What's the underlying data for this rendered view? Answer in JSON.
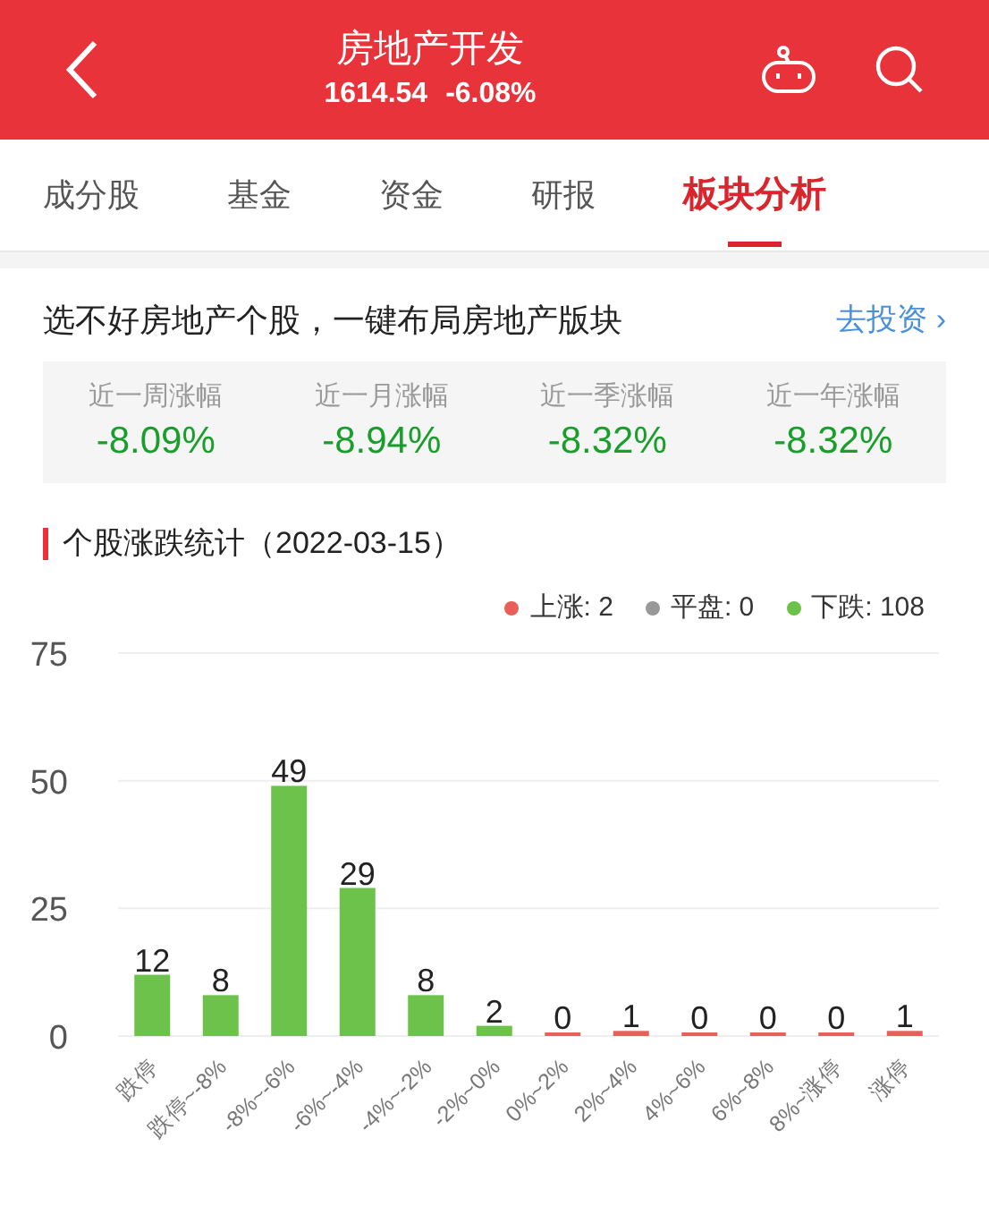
{
  "header": {
    "title": "房地产开发",
    "price": "1614.54",
    "change": "-6.08%"
  },
  "tabs": [
    {
      "label": "成分股",
      "selected": false
    },
    {
      "label": "基金",
      "selected": false
    },
    {
      "label": "资金",
      "selected": false
    },
    {
      "label": "研报",
      "selected": false
    },
    {
      "label": "板块分析",
      "selected": true
    }
  ],
  "promo": {
    "text": "选不好房地产个股，一键布局房地产版块",
    "link": "去投资",
    "arrow": "›"
  },
  "stats": [
    {
      "label": "近一周涨幅",
      "value": "-8.09%"
    },
    {
      "label": "近一月涨幅",
      "value": "-8.94%"
    },
    {
      "label": "近一季涨幅",
      "value": "-8.32%"
    },
    {
      "label": "近一年涨幅",
      "value": "-8.32%"
    }
  ],
  "section": {
    "title": "个股涨跌统计（2022-03-15）",
    "legend": [
      {
        "label": "上涨: 2",
        "color": "#e8605a"
      },
      {
        "label": "平盘: 0",
        "color": "#999999"
      },
      {
        "label": "下跌: 108",
        "color": "#6cc24a"
      }
    ],
    "chart_data": {
      "type": "bar",
      "categories": [
        "跌停",
        "跌停~-8%",
        "-8%~-6%",
        "-6%~-4%",
        "-4%~-2%",
        "-2%~0%",
        "0%~2%",
        "2%~4%",
        "4%~6%",
        "6%~8%",
        "8%~涨停",
        "涨停"
      ],
      "series": [
        {
          "color": "#6cc24a",
          "values": [
            12,
            8,
            49,
            29,
            8,
            2,
            null,
            null,
            null,
            null,
            null,
            null
          ]
        },
        {
          "color": "#e8605a",
          "values": [
            null,
            null,
            null,
            null,
            null,
            null,
            0,
            1,
            0,
            0,
            0,
            1
          ]
        }
      ],
      "ylim": [
        0,
        75
      ],
      "yticks": [
        0,
        25,
        50,
        75
      ],
      "data_labels": true
    }
  }
}
